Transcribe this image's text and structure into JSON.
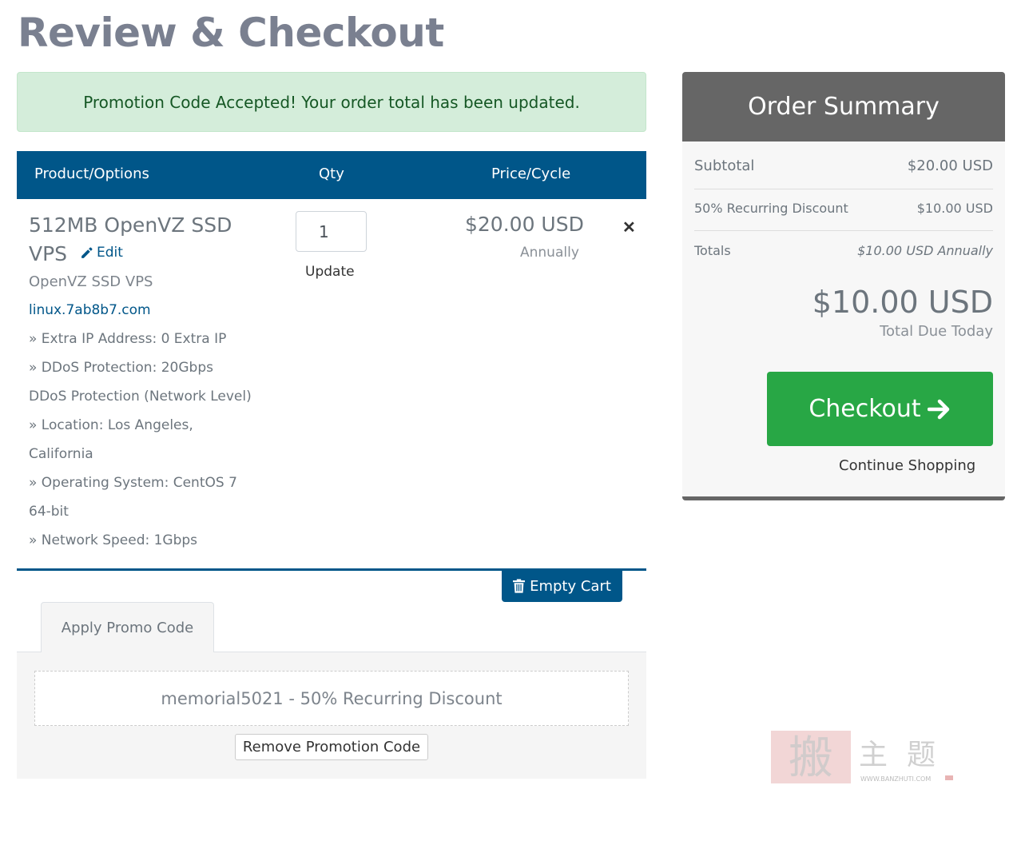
{
  "page": {
    "title": "Review & Checkout"
  },
  "alert": {
    "message": "Promotion Code Accepted! Your order total has been updated."
  },
  "cart_header": {
    "product": "Product/Options",
    "qty": "Qty",
    "price": "Price/Cycle"
  },
  "item": {
    "name_line1": "512MB OpenVZ SSD",
    "name_line2": "VPS",
    "edit_label": "Edit",
    "group": "OpenVZ SSD VPS",
    "domain": "linux.7ab8b7.com",
    "options": [
      "» Extra IP Address: 0 Extra IP",
      "» DDoS Protection: 20Gbps",
      "DDoS Protection (Network Level)",
      "» Location: Los Angeles,",
      "California",
      "» Operating System: CentOS 7",
      "64-bit",
      "» Network Speed: 1Gbps"
    ],
    "qty": "1",
    "update_label": "Update",
    "price": "$20.00 USD",
    "cycle": "Annually",
    "remove_glyph": "✕"
  },
  "empty_cart_label": "Empty Cart",
  "promo": {
    "tab_label": "Apply Promo Code",
    "applied": "memorial5021 - 50% Recurring Discount",
    "remove_label": "Remove Promotion Code"
  },
  "summary": {
    "title": "Order Summary",
    "subtotal_label": "Subtotal",
    "subtotal_value": "$20.00 USD",
    "discount_label": "50% Recurring Discount",
    "discount_value": "$10.00 USD",
    "totals_label": "Totals",
    "totals_value": "$10.00 USD Annually",
    "total_due": "$10.00 USD",
    "total_due_label": "Total Due Today",
    "checkout_label": "Checkout",
    "continue_label": "Continue Shopping"
  },
  "watermark": {
    "text": "搬 主 题",
    "url": "WWW.BANZHUTI.COM"
  },
  "colors": {
    "primary": "#005689",
    "success": "#28a745",
    "summary_head": "#666666",
    "alert_bg": "#d4edda"
  }
}
